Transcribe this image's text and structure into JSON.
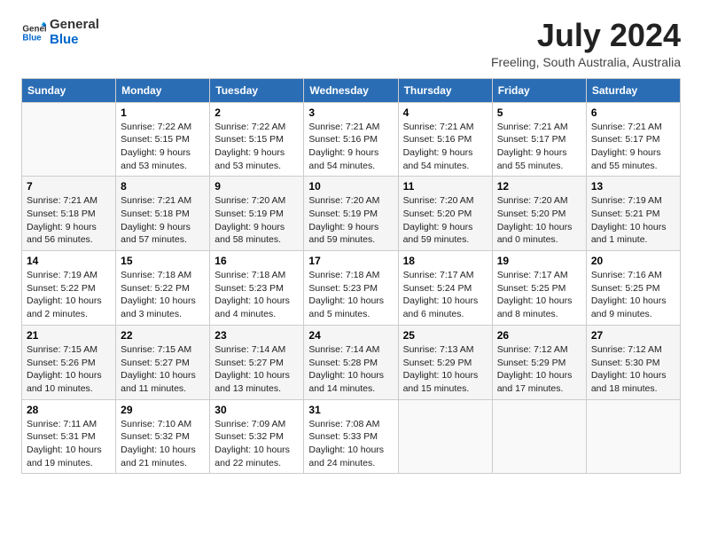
{
  "logo": {
    "line1": "General",
    "line2": "Blue"
  },
  "title": "July 2024",
  "subtitle": "Freeling, South Australia, Australia",
  "header_days": [
    "Sunday",
    "Monday",
    "Tuesday",
    "Wednesday",
    "Thursday",
    "Friday",
    "Saturday"
  ],
  "weeks": [
    [
      {
        "num": "",
        "info": ""
      },
      {
        "num": "1",
        "info": "Sunrise: 7:22 AM\nSunset: 5:15 PM\nDaylight: 9 hours\nand 53 minutes."
      },
      {
        "num": "2",
        "info": "Sunrise: 7:22 AM\nSunset: 5:15 PM\nDaylight: 9 hours\nand 53 minutes."
      },
      {
        "num": "3",
        "info": "Sunrise: 7:21 AM\nSunset: 5:16 PM\nDaylight: 9 hours\nand 54 minutes."
      },
      {
        "num": "4",
        "info": "Sunrise: 7:21 AM\nSunset: 5:16 PM\nDaylight: 9 hours\nand 54 minutes."
      },
      {
        "num": "5",
        "info": "Sunrise: 7:21 AM\nSunset: 5:17 PM\nDaylight: 9 hours\nand 55 minutes."
      },
      {
        "num": "6",
        "info": "Sunrise: 7:21 AM\nSunset: 5:17 PM\nDaylight: 9 hours\nand 55 minutes."
      }
    ],
    [
      {
        "num": "7",
        "info": "Sunrise: 7:21 AM\nSunset: 5:18 PM\nDaylight: 9 hours\nand 56 minutes."
      },
      {
        "num": "8",
        "info": "Sunrise: 7:21 AM\nSunset: 5:18 PM\nDaylight: 9 hours\nand 57 minutes."
      },
      {
        "num": "9",
        "info": "Sunrise: 7:20 AM\nSunset: 5:19 PM\nDaylight: 9 hours\nand 58 minutes."
      },
      {
        "num": "10",
        "info": "Sunrise: 7:20 AM\nSunset: 5:19 PM\nDaylight: 9 hours\nand 59 minutes."
      },
      {
        "num": "11",
        "info": "Sunrise: 7:20 AM\nSunset: 5:20 PM\nDaylight: 9 hours\nand 59 minutes."
      },
      {
        "num": "12",
        "info": "Sunrise: 7:20 AM\nSunset: 5:20 PM\nDaylight: 10 hours\nand 0 minutes."
      },
      {
        "num": "13",
        "info": "Sunrise: 7:19 AM\nSunset: 5:21 PM\nDaylight: 10 hours\nand 1 minute."
      }
    ],
    [
      {
        "num": "14",
        "info": "Sunrise: 7:19 AM\nSunset: 5:22 PM\nDaylight: 10 hours\nand 2 minutes."
      },
      {
        "num": "15",
        "info": "Sunrise: 7:18 AM\nSunset: 5:22 PM\nDaylight: 10 hours\nand 3 minutes."
      },
      {
        "num": "16",
        "info": "Sunrise: 7:18 AM\nSunset: 5:23 PM\nDaylight: 10 hours\nand 4 minutes."
      },
      {
        "num": "17",
        "info": "Sunrise: 7:18 AM\nSunset: 5:23 PM\nDaylight: 10 hours\nand 5 minutes."
      },
      {
        "num": "18",
        "info": "Sunrise: 7:17 AM\nSunset: 5:24 PM\nDaylight: 10 hours\nand 6 minutes."
      },
      {
        "num": "19",
        "info": "Sunrise: 7:17 AM\nSunset: 5:25 PM\nDaylight: 10 hours\nand 8 minutes."
      },
      {
        "num": "20",
        "info": "Sunrise: 7:16 AM\nSunset: 5:25 PM\nDaylight: 10 hours\nand 9 minutes."
      }
    ],
    [
      {
        "num": "21",
        "info": "Sunrise: 7:15 AM\nSunset: 5:26 PM\nDaylight: 10 hours\nand 10 minutes."
      },
      {
        "num": "22",
        "info": "Sunrise: 7:15 AM\nSunset: 5:27 PM\nDaylight: 10 hours\nand 11 minutes."
      },
      {
        "num": "23",
        "info": "Sunrise: 7:14 AM\nSunset: 5:27 PM\nDaylight: 10 hours\nand 13 minutes."
      },
      {
        "num": "24",
        "info": "Sunrise: 7:14 AM\nSunset: 5:28 PM\nDaylight: 10 hours\nand 14 minutes."
      },
      {
        "num": "25",
        "info": "Sunrise: 7:13 AM\nSunset: 5:29 PM\nDaylight: 10 hours\nand 15 minutes."
      },
      {
        "num": "26",
        "info": "Sunrise: 7:12 AM\nSunset: 5:29 PM\nDaylight: 10 hours\nand 17 minutes."
      },
      {
        "num": "27",
        "info": "Sunrise: 7:12 AM\nSunset: 5:30 PM\nDaylight: 10 hours\nand 18 minutes."
      }
    ],
    [
      {
        "num": "28",
        "info": "Sunrise: 7:11 AM\nSunset: 5:31 PM\nDaylight: 10 hours\nand 19 minutes."
      },
      {
        "num": "29",
        "info": "Sunrise: 7:10 AM\nSunset: 5:32 PM\nDaylight: 10 hours\nand 21 minutes."
      },
      {
        "num": "30",
        "info": "Sunrise: 7:09 AM\nSunset: 5:32 PM\nDaylight: 10 hours\nand 22 minutes."
      },
      {
        "num": "31",
        "info": "Sunrise: 7:08 AM\nSunset: 5:33 PM\nDaylight: 10 hours\nand 24 minutes."
      },
      {
        "num": "",
        "info": ""
      },
      {
        "num": "",
        "info": ""
      },
      {
        "num": "",
        "info": ""
      }
    ]
  ]
}
